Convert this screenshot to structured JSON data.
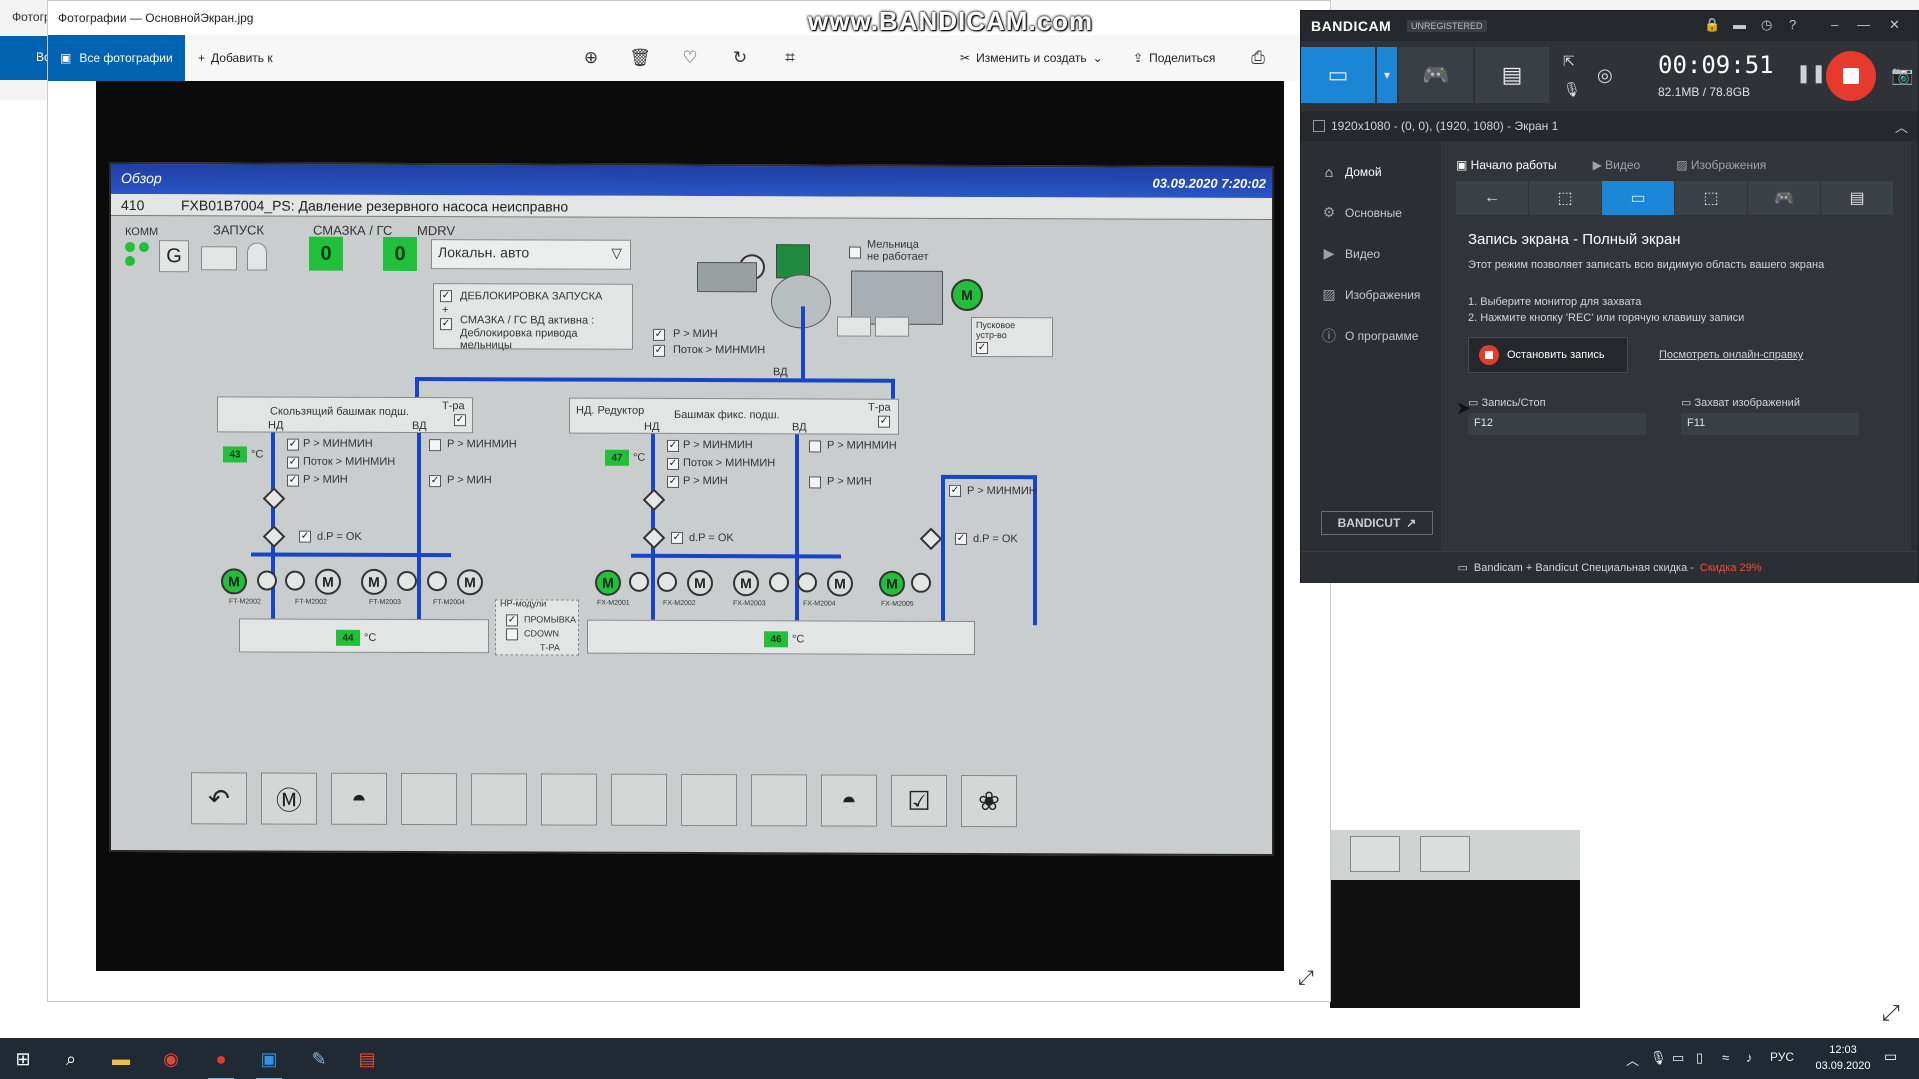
{
  "background": {
    "title": "Фотогр",
    "toolbar_label": "Вс"
  },
  "photos": {
    "title": "Фотографии — ОсновнойЭкран.jpg",
    "all_photos": "Все фотографии",
    "add_to": "Добавить к",
    "edit_create": "Изменить и создать",
    "share": "Поделиться"
  },
  "watermark": "www.BANDICAM.com",
  "hmi": {
    "header_title": "Обзор",
    "header_datetime": "03.09.2020 7:20:02",
    "alarm_num": "410",
    "alarm_msg": "FXB01B7004_PS:  Давление резервного насоса неисправно",
    "tabs": [
      "КОММ",
      "ЗАПУСК",
      "СМАЗКА / ГС",
      "MDRV"
    ],
    "g_label": "G",
    "counter1": "0",
    "counter2": "0",
    "mode": "Локальн. авто",
    "unlock_title": "ДЕБЛОКИРОВКА ЗАПУСКА",
    "unlock_plus": "+",
    "unlock_line1": "СМАЗКА / ГС ВД активна :",
    "unlock_line2": "Деблокировка привода мельницы",
    "mill_line1": "Мельница",
    "mill_line2": "не работает",
    "p_min": "P > МИН",
    "flow_minmin": "Поток > МИНМИН",
    "vd": "ВД",
    "nd": "НД",
    "t_ra": "Т-ра",
    "bearing_left": "Скользящий башмак подш.",
    "bearing_right": "Башмак фикс. подш.",
    "gearbox": "НД. Редуктор",
    "temp_left": "43",
    "temp_mid": "47",
    "temp_bottom_left": "44",
    "temp_bottom_right": "46",
    "unit_c": "°C",
    "p_minmin": "P > МИНМИН",
    "dp_ok": "d.P = OK",
    "hp_modules": "HP-модули",
    "flush": "ПРОМЫВКА",
    "cdown": "CDOWN",
    "t_ra_small": "Т-РА",
    "starter": "Пусковое устр-во",
    "motor": "M",
    "pump_labels": [
      "FT-M2002",
      "FT-M2003",
      "FT-M2004",
      "FX-M2001",
      "FX-M2002",
      "FX-M2003",
      "FX-M2004",
      "FX-M2005"
    ]
  },
  "bandicam": {
    "brand": "BANDICAM",
    "unregistered": "UNREGISTERED",
    "timer": "00:09:51",
    "size": "82.1MB / 78.8GB",
    "resolution": "1920x1080 - (0, 0), (1920, 1080) - Экран 1",
    "sidebar": [
      "Домой",
      "Основные",
      "Видео",
      "Изображения",
      "О программе"
    ],
    "tabs": [
      "Начало работы",
      "Видео",
      "Изображения"
    ],
    "heading": "Запись экрана - Полный экран",
    "description": "Этот режим позволяет записать всю видимую область вашего экрана",
    "step1": "1. Выберите монитор для захвата",
    "step2": "2. Нажмите кнопку 'REC' или горячую клавишу записи",
    "stop_label": "Остановить запись",
    "help_link": "Посмотреть онлайн-справку",
    "hotkey_rec_label": "Запись/Стоп",
    "hotkey_rec": "F12",
    "hotkey_img_label": "Захват изображений",
    "hotkey_img": "F11",
    "bandicut": "BANDICUT",
    "promo": "Bandicam + Bandicut Специальная скидка -",
    "promo_discount": "Скидка 29%"
  },
  "taskbar": {
    "lang": "РУС",
    "time": "12:03",
    "date": "03.09.2020"
  }
}
